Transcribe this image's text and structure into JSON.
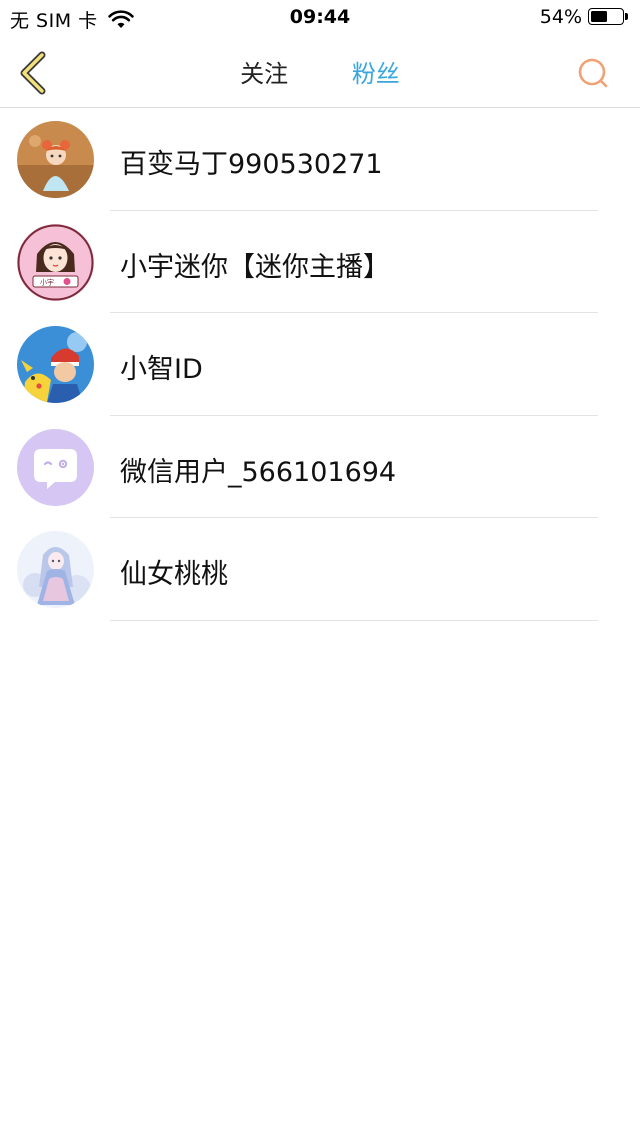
{
  "status_bar": {
    "carrier": "无 SIM 卡",
    "time": "09:44",
    "battery_percent": "54%",
    "battery_level": 0.54
  },
  "nav": {
    "back_icon": "chevron-left-icon",
    "tabs": [
      {
        "label": "关注",
        "active": false
      },
      {
        "label": "粉丝",
        "active": true
      }
    ],
    "search_icon": "search-icon",
    "active_color": "#3aa6e0",
    "search_color": "#f0a274",
    "back_color": "#f3e17a"
  },
  "fans": [
    {
      "name": "百变马丁990530271",
      "avatar": "cartoon-girl-avatar"
    },
    {
      "name": "小宇迷你【迷你主播】",
      "avatar": "anime-girl-avatar",
      "avatar_badge": "小宇"
    },
    {
      "name": "小智ID",
      "avatar": "pokemon-trainer-avatar"
    },
    {
      "name": "微信用户_566101694",
      "avatar": "default-chat-avatar"
    },
    {
      "name": "仙女桃桃",
      "avatar": "fairy-avatar"
    }
  ]
}
